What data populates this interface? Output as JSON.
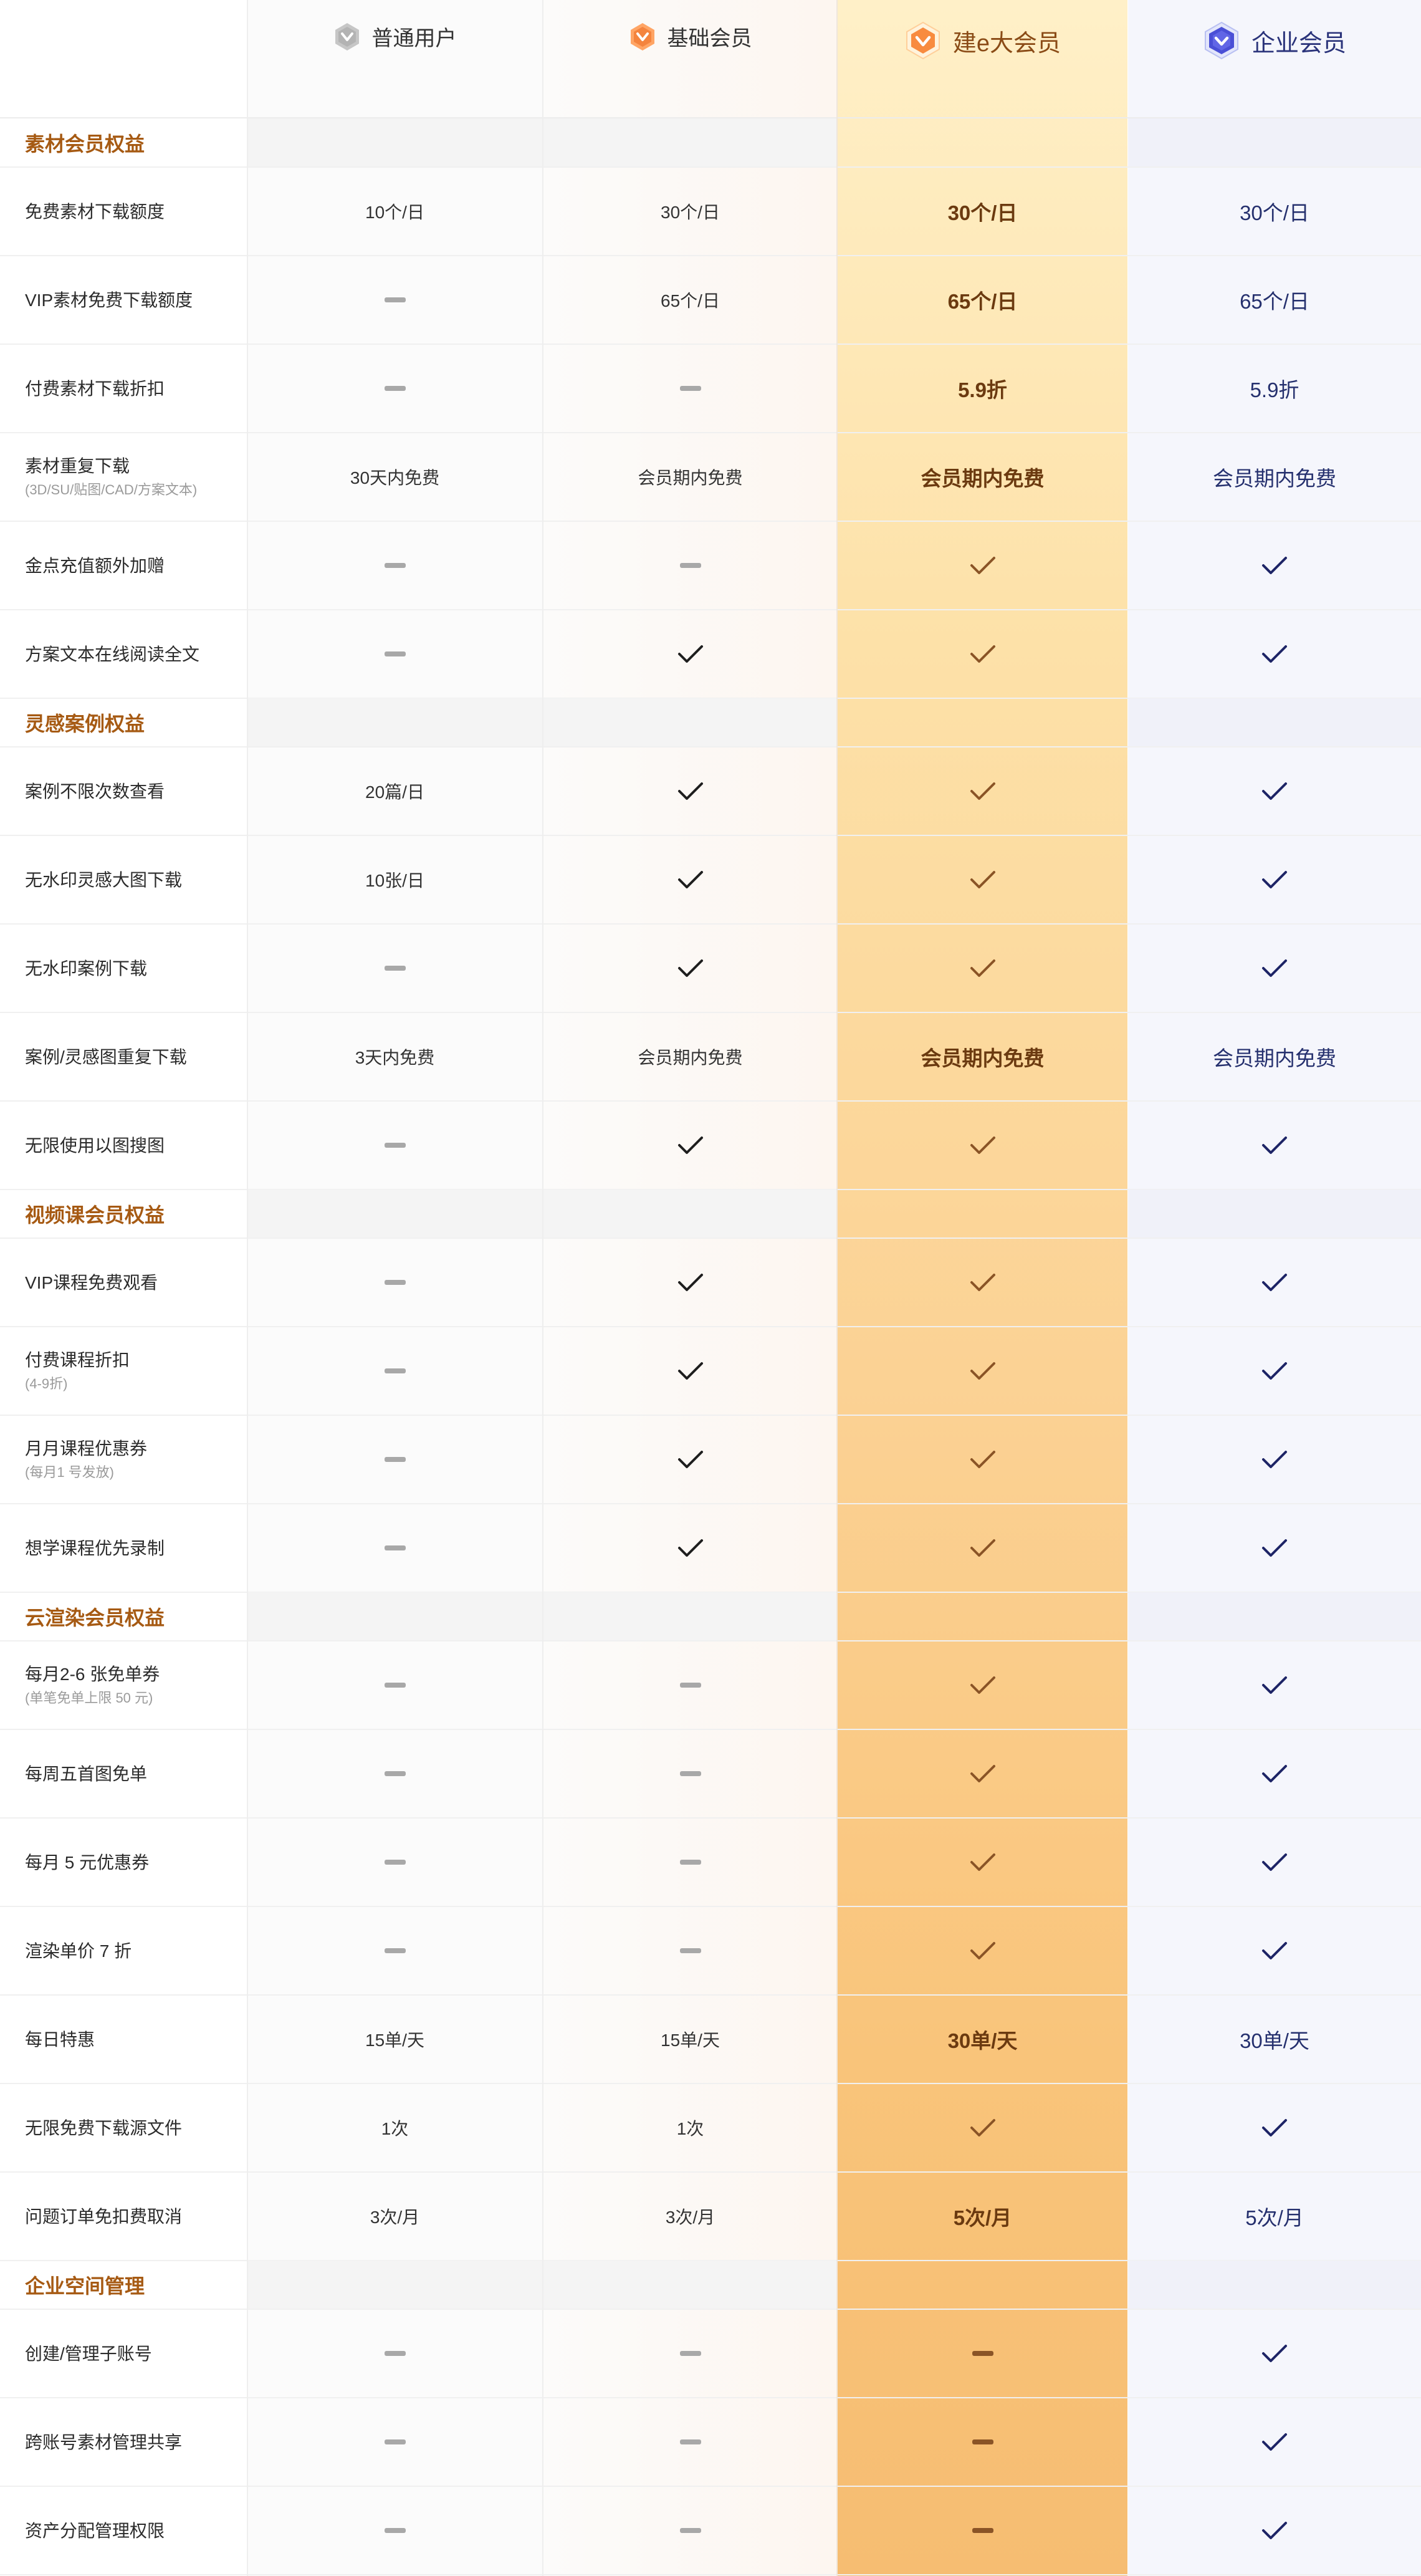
{
  "plans": [
    {
      "name": "普通用户",
      "icon": "gray-hexagon-badge-icon"
    },
    {
      "name": "基础会员",
      "icon": "orange-hexagon-badge-icon"
    },
    {
      "name": "建e大会员",
      "icon": "gold-hexagon-badge-icon"
    },
    {
      "name": "企业会员",
      "icon": "blue-shield-badge-icon"
    }
  ],
  "colors": {
    "section_title": "#a65a13",
    "premium_text": "#6b3a10",
    "enterprise_text": "#25306e",
    "premium_column_top": "#fff0c8",
    "premium_column_bottom": "#f6bd72",
    "enterprise_column": "#f5f6fc"
  },
  "value_legend": {
    "check": "check-icon (included)",
    "dash": "dash-icon (not included)"
  },
  "sections": [
    {
      "title": "素材会员权益",
      "rows": [
        {
          "label": "免费素材下载额度",
          "note": "",
          "values": [
            "10个/日",
            "30个/日",
            "30个/日",
            "30个/日"
          ]
        },
        {
          "label": "VIP素材免费下载额度",
          "note": "",
          "values": [
            "dash",
            "65个/日",
            "65个/日",
            "65个/日"
          ]
        },
        {
          "label": "付费素材下载折扣",
          "note": "",
          "values": [
            "dash",
            "dash",
            "5.9折",
            "5.9折"
          ]
        },
        {
          "label": "素材重复下载",
          "note": "(3D/SU/贴图/CAD/方案文本)",
          "values": [
            "30天内免费",
            "会员期内免费",
            "会员期内免费",
            "会员期内免费"
          ]
        },
        {
          "label": "金点充值额外加赠",
          "note": "",
          "values": [
            "dash",
            "dash",
            "check",
            "check"
          ]
        },
        {
          "label": "方案文本在线阅读全文",
          "note": "",
          "values": [
            "dash",
            "check",
            "check",
            "check"
          ]
        }
      ]
    },
    {
      "title": "灵感案例权益",
      "rows": [
        {
          "label": "案例不限次数查看",
          "note": "",
          "values": [
            "20篇/日",
            "check",
            "check",
            "check"
          ]
        },
        {
          "label": "无水印灵感大图下载",
          "note": "",
          "values": [
            "10张/日",
            "check",
            "check",
            "check"
          ]
        },
        {
          "label": "无水印案例下载",
          "note": "",
          "values": [
            "dash",
            "check",
            "check",
            "check"
          ]
        },
        {
          "label": "案例/灵感图重复下载",
          "note": "",
          "values": [
            "3天内免费",
            "会员期内免费",
            "会员期内免费",
            "会员期内免费"
          ]
        },
        {
          "label": "无限使用以图搜图",
          "note": "",
          "values": [
            "dash",
            "check",
            "check",
            "check"
          ]
        }
      ]
    },
    {
      "title": "视频课会员权益",
      "rows": [
        {
          "label": "VIP课程免费观看",
          "note": "",
          "values": [
            "dash",
            "check",
            "check",
            "check"
          ]
        },
        {
          "label": "付费课程折扣",
          "note": "(4-9折)",
          "values": [
            "dash",
            "check",
            "check",
            "check"
          ]
        },
        {
          "label": "月月课程优惠券",
          "note": "(每月1 号发放)",
          "values": [
            "dash",
            "check",
            "check",
            "check"
          ]
        },
        {
          "label": "想学课程优先录制",
          "note": "",
          "values": [
            "dash",
            "check",
            "check",
            "check"
          ]
        }
      ]
    },
    {
      "title": "云渲染会员权益",
      "rows": [
        {
          "label": "每月2-6 张免单券",
          "note": "(单笔免单上限 50 元)",
          "values": [
            "dash",
            "dash",
            "check",
            "check"
          ]
        },
        {
          "label": "每周五首图免单",
          "note": "",
          "values": [
            "dash",
            "dash",
            "check",
            "check"
          ]
        },
        {
          "label": "每月 5 元优惠券",
          "note": "",
          "values": [
            "dash",
            "dash",
            "check",
            "check"
          ]
        },
        {
          "label": "渲染单价 7 折",
          "note": "",
          "values": [
            "dash",
            "dash",
            "check",
            "check"
          ]
        },
        {
          "label": "每日特惠",
          "note": "",
          "values": [
            "15单/天",
            "15单/天",
            "30单/天",
            "30单/天"
          ]
        },
        {
          "label": "无限免费下载源文件",
          "note": "",
          "values": [
            "1次",
            "1次",
            "check",
            "check"
          ]
        },
        {
          "label": "问题订单免扣费取消",
          "note": "",
          "values": [
            "3次/月",
            "3次/月",
            "5次/月",
            "5次/月"
          ]
        }
      ]
    },
    {
      "title": "企业空间管理",
      "rows": [
        {
          "label": "创建/管理子账号",
          "note": "",
          "values": [
            "dash",
            "dash",
            "dash",
            "check"
          ]
        },
        {
          "label": "跨账号素材管理共享",
          "note": "",
          "values": [
            "dash",
            "dash",
            "dash",
            "check"
          ]
        },
        {
          "label": "资产分配管理权限",
          "note": "",
          "values": [
            "dash",
            "dash",
            "dash",
            "check"
          ]
        }
      ]
    }
  ]
}
